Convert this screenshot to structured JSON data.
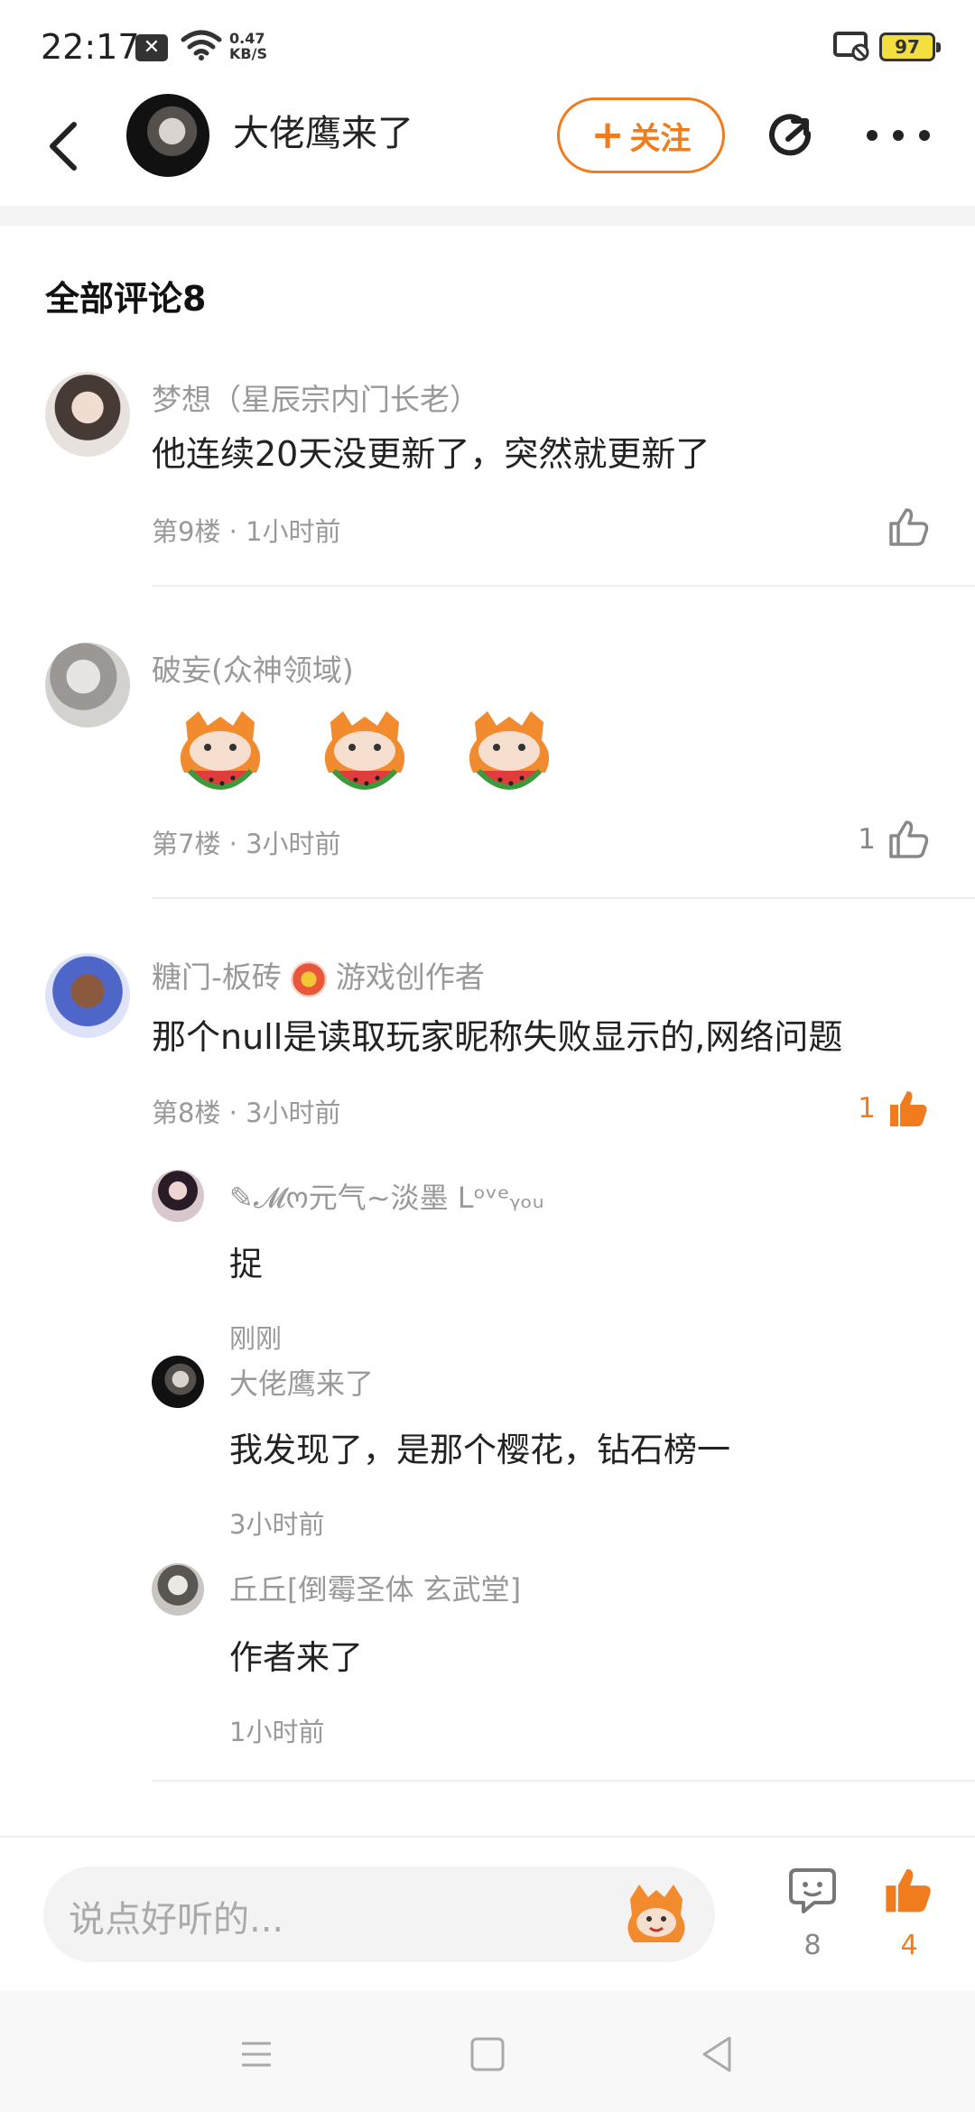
{
  "status_bar": {
    "time": "22:17",
    "net_speed": "0.47",
    "net_unit": "KB/S",
    "battery": "97"
  },
  "header": {
    "title": "大佬鹰来了",
    "follow_label": "关注",
    "follow_plus": "+",
    "accent_color": "#f07c1e"
  },
  "comments_section": {
    "title": "全部评论8"
  },
  "comments": [
    {
      "username": "梦想（星辰宗内门长老）",
      "content": "他连续20天没更新了，突然就更新了",
      "floor": "第9楼",
      "time": "1小时前",
      "likes": ""
    },
    {
      "username": "破妄(众神领域)",
      "content": "",
      "floor": "第7楼",
      "time": "3小时前",
      "likes": "1",
      "stickers": [
        "watermelon-sticker",
        "watermelon-sticker",
        "watermelon-sticker"
      ]
    },
    {
      "username": "糖门-板砖",
      "badge": "游戏创作者",
      "content": "那个null是读取玩家昵称失败显示的,网络问题",
      "floor": "第8楼",
      "time": "3小时前",
      "likes": "1",
      "replies": [
        {
          "username": "✎𝓜ო元气~淡墨 Lᵒᵛᵉᵧₒᵤ",
          "content": "捉",
          "time": "刚刚"
        },
        {
          "username": "大佬鹰来了",
          "content": "我发现了，是那个樱花，钻石榜一",
          "time": "3小时前"
        },
        {
          "username": "丘丘[倒霉圣体 玄武堂]",
          "content": "作者来了",
          "time": "1小时前"
        }
      ]
    }
  ],
  "meta_separator": "·",
  "bottom_bar": {
    "placeholder": "说点好听的...",
    "comment_count": "8",
    "like_count": "4"
  },
  "nav": {
    "icons": [
      "menu-icon",
      "home-square-icon",
      "back-triangle-icon"
    ]
  }
}
